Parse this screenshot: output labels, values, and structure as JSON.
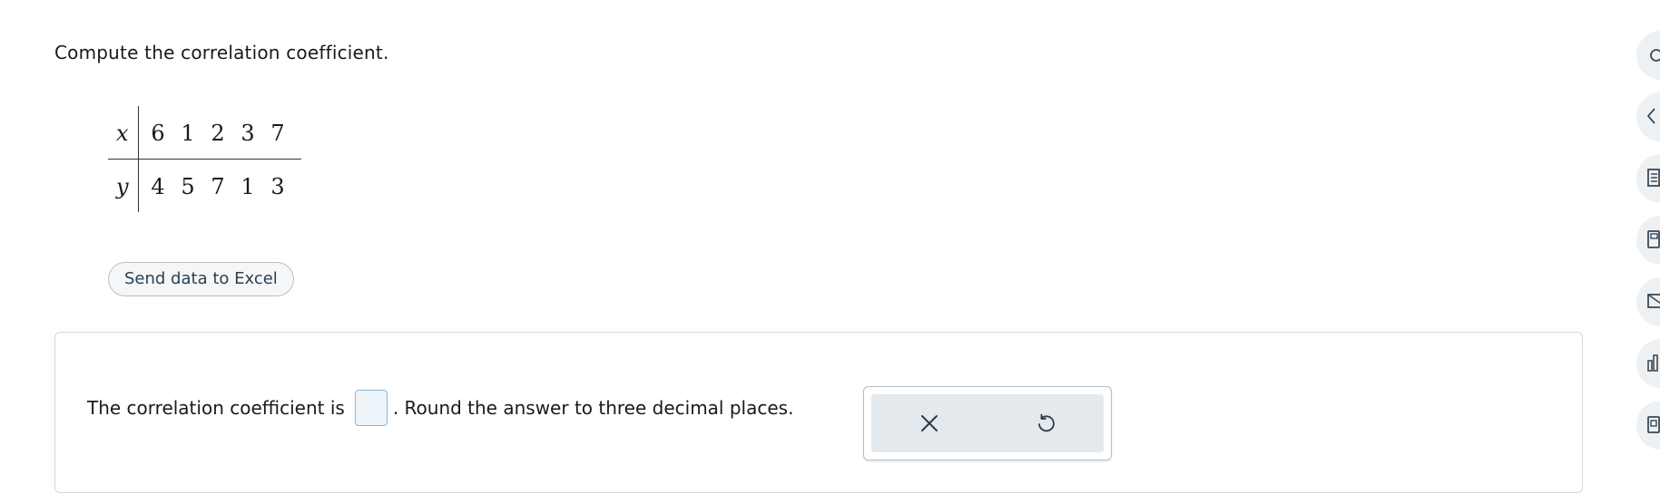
{
  "question": {
    "prompt": "Compute the correlation coefficient."
  },
  "data_table": {
    "rows": [
      {
        "label": "x",
        "values": [
          "6",
          "1",
          "2",
          "3",
          "7"
        ]
      },
      {
        "label": "y",
        "values": [
          "4",
          "5",
          "7",
          "1",
          "3"
        ]
      }
    ]
  },
  "excel_button": {
    "label": "Send data to Excel"
  },
  "answer": {
    "prefix": "The correlation coefficient is",
    "input_value": "",
    "suffix": ". Round the answer to three decimal places."
  },
  "tools": {
    "clear_icon": "close-icon",
    "undo_icon": "undo-icon"
  },
  "sidebar": {
    "items": [
      {
        "icon": "question-icon"
      },
      {
        "icon": "eraser-icon"
      },
      {
        "icon": "notes-icon"
      },
      {
        "icon": "calculator-icon"
      },
      {
        "icon": "mail-icon"
      },
      {
        "icon": "chart-icon"
      },
      {
        "icon": "calendar-icon"
      }
    ]
  },
  "colors": {
    "accent": "#2a4053",
    "input_border": "#8fb4cc",
    "tool_bg": "#e4e9ee"
  }
}
